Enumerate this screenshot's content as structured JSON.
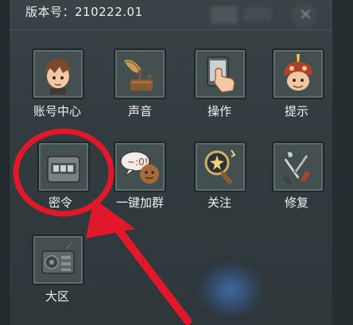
{
  "header": {
    "version_text": "版本号：210222.01",
    "close_glyph": "✕"
  },
  "grid": {
    "items": [
      {
        "label": "账号中心",
        "icon": "avatar-icon"
      },
      {
        "label": "声音",
        "icon": "gramophone-icon"
      },
      {
        "label": "操作",
        "icon": "hand-tap-icon"
      },
      {
        "label": "提示",
        "icon": "mushroom-helmet-icon"
      },
      {
        "label": "密令",
        "icon": "code-box-icon"
      },
      {
        "label": "一键加群",
        "icon": "chat-bubble-icon"
      },
      {
        "label": "关注",
        "icon": "magnifier-icon"
      },
      {
        "label": "修复",
        "icon": "tools-icon"
      },
      {
        "label": "大区",
        "icon": "radio-icon"
      }
    ]
  },
  "annotation": {
    "circle_color": "#e3172a",
    "arrow_color": "#e3172a"
  }
}
